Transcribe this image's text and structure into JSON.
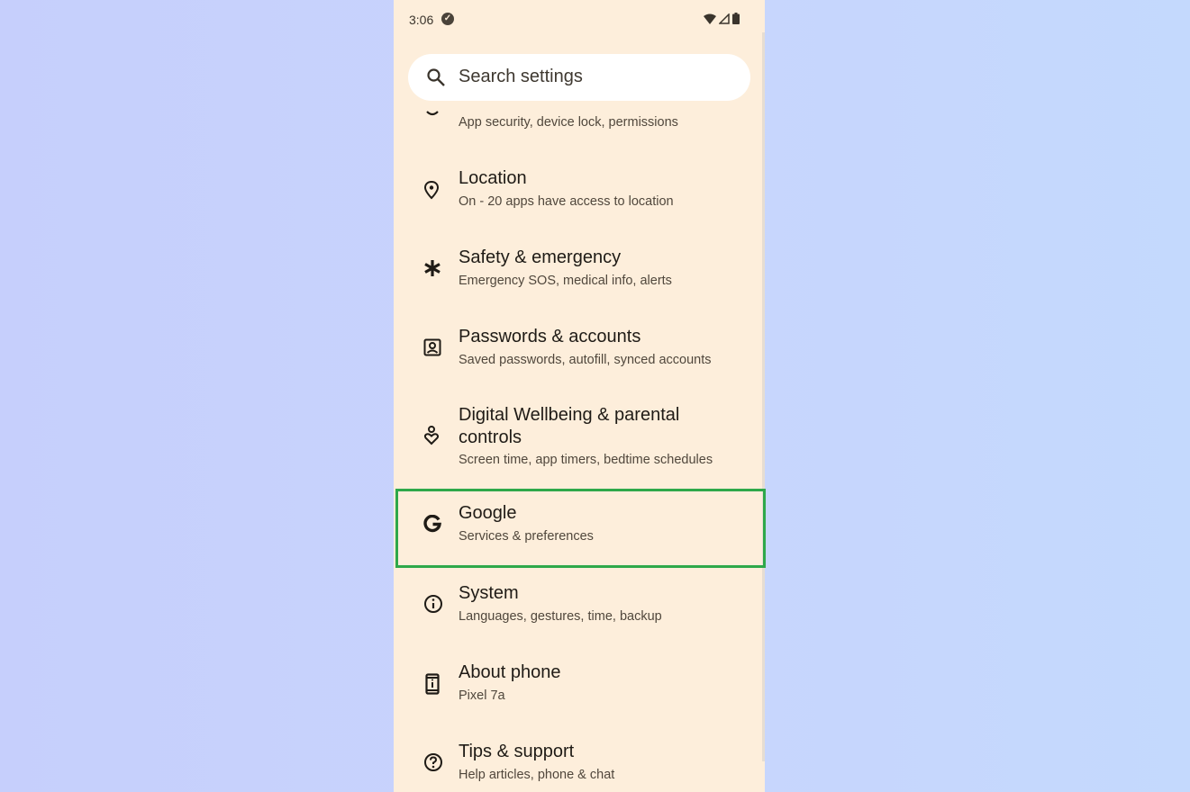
{
  "status_bar": {
    "time": "3:06",
    "icons": [
      "check-circle-icon",
      "wifi-icon",
      "signal-icon",
      "battery-icon"
    ]
  },
  "search": {
    "placeholder": "Search settings",
    "icon": "search-icon"
  },
  "items": [
    {
      "title": "",
      "subtitle": "App security, device lock, permissions",
      "icon": "security-icon"
    },
    {
      "title": "Location",
      "subtitle": "On - 20 apps have access to location",
      "icon": "location-pin-icon"
    },
    {
      "title": "Safety & emergency",
      "subtitle": "Emergency SOS, medical info, alerts",
      "icon": "asterisk-icon"
    },
    {
      "title": "Passwords & accounts",
      "subtitle": "Saved passwords, autofill, synced accounts",
      "icon": "account-box-icon"
    },
    {
      "title": "Digital Wellbeing & parental controls",
      "subtitle": "Screen time, app timers, bedtime schedules",
      "icon": "wellbeing-icon"
    },
    {
      "title": "Google",
      "subtitle": "Services & preferences",
      "icon": "google-icon"
    },
    {
      "title": "System",
      "subtitle": "Languages, gestures, time, backup",
      "icon": "info-icon"
    },
    {
      "title": "About phone",
      "subtitle": "Pixel 7a",
      "icon": "phone-info-icon"
    },
    {
      "title": "Tips & support",
      "subtitle": "Help articles, phone & chat",
      "icon": "help-icon"
    }
  ],
  "highlight": {
    "item": "Google",
    "color": "#2ea84a"
  }
}
